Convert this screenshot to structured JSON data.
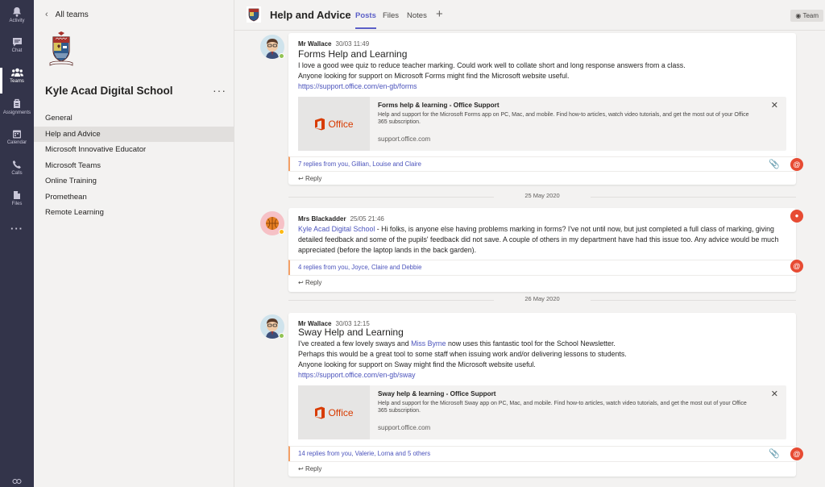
{
  "rail": [
    {
      "label": "Activity",
      "icon": "bell-icon"
    },
    {
      "label": "Chat",
      "icon": "chat-icon"
    },
    {
      "label": "Teams",
      "icon": "teams-icon"
    },
    {
      "label": "Assignments",
      "icon": "assignments-icon"
    },
    {
      "label": "Calendar",
      "icon": "calendar-icon"
    },
    {
      "label": "Calls",
      "icon": "phone-icon"
    },
    {
      "label": "Files",
      "icon": "files-icon"
    },
    {
      "label": "",
      "icon": "more-icon"
    }
  ],
  "teams_pane": {
    "back_label": "All teams",
    "team_name": "Kyle Acad Digital School",
    "more": "···",
    "channels": [
      "General",
      "Help and Advice",
      "Microsoft Innovative Educator",
      "Microsoft Teams",
      "Online Training",
      "Promethean",
      "Remote Learning"
    ],
    "active_channel": "Help and Advice"
  },
  "header": {
    "title": "Help and Advice",
    "tabs": [
      "Posts",
      "Files",
      "Notes"
    ],
    "active_tab": "Posts",
    "add": "+",
    "team_button": "Team"
  },
  "posts": [
    {
      "author": "Mr Wallace",
      "time": "30/03 11:49",
      "title": "Forms Help and Learning",
      "lines": [
        "I love a good wee quiz to reduce teacher marking.  Could work well to collate short and long response answers from a class.",
        "Anyone looking for support on Microsoft Forms might find the Microsoft website useful."
      ],
      "link": "https://support.office.com/en-gb/forms",
      "card": {
        "logo": "Office",
        "title": "Forms help & learning - Office Support",
        "desc": "Help and support for the Microsoft Forms app on PC, Mac, and mobile. Find how-to articles, watch video tutorials, and get the most out of your Office 365 subscription.",
        "url": "support.office.com"
      },
      "replies": "7 replies from you, Gillian, Louise and Claire",
      "reply_label": "Reply"
    },
    {
      "date": "25 May 2020",
      "author": "Mrs Blackadder",
      "time": "25/05 21:46",
      "mention": "Kyle Acad Digital School",
      "body": " - Hi folks, is anyone else having problems marking in forms? I've not until now, but just completed a full class of marking, giving detailed feedback and some of the pupils' feedback did not save. A couple of others in my department have had this issue too. Any advice would be much appreciated (before the laptop lands in the back garden).",
      "replies": "4 replies from you, Joyce, Claire and Debbie",
      "reply_label": "Reply"
    },
    {
      "date": "26 May 2020",
      "author": "Mr Wallace",
      "time": "30/03 12:15",
      "title": "Sway Help and Learning",
      "line1_pre": "I've created a few lovely sways and ",
      "line1_mention": "Miss Byrne",
      "line1_post": " now uses this fantastic tool for the School Newsletter.",
      "lines": [
        "Perhaps this would be a great tool to some staff when issuing work and/or delivering lessons to students.",
        "Anyone looking for support on Sway might find the Microsoft website useful."
      ],
      "link": "https://support.office.com/en-gb/sway",
      "card": {
        "logo": "Office",
        "title": "Sway help & learning - Office Support",
        "desc": "Help and support for the Microsoft Sway app on PC, Mac, and mobile. Find how-to articles, watch video tutorials, and get the most out of your Office 365 subscription.",
        "url": "support.office.com"
      },
      "replies": "14 replies from you, Valerie, Lorna and 5 others",
      "reply_label": "Reply"
    }
  ],
  "colors": {
    "rail": "#33344a",
    "accent": "#5b5fc7",
    "mention": "#e74b33",
    "office": "#d83b01"
  }
}
